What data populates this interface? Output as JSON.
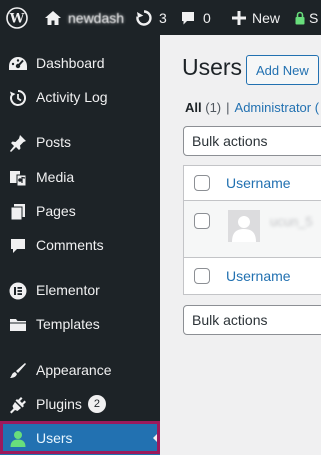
{
  "adminbar": {
    "site_name": "newdash",
    "updates_count": "3",
    "comments_count": "0",
    "new_label": "New",
    "seo_label": "S"
  },
  "sidebar": {
    "items": [
      {
        "label": "Dashboard",
        "icon": "dashboard-icon"
      },
      {
        "label": "Activity Log",
        "icon": "history-icon"
      },
      {
        "label": "Posts",
        "icon": "pin-icon"
      },
      {
        "label": "Media",
        "icon": "media-icon"
      },
      {
        "label": "Pages",
        "icon": "pages-icon"
      },
      {
        "label": "Comments",
        "icon": "comment-icon"
      },
      {
        "label": "Elementor",
        "icon": "elementor-icon"
      },
      {
        "label": "Templates",
        "icon": "folder-icon"
      },
      {
        "label": "Appearance",
        "icon": "brush-icon"
      },
      {
        "label": "Plugins",
        "icon": "plugin-icon",
        "badge": "2"
      },
      {
        "label": "Users",
        "icon": "users-icon",
        "active": true
      }
    ]
  },
  "main": {
    "title": "Users",
    "add_new": "Add New",
    "filters": {
      "all_label": "All",
      "all_count": "(1)",
      "separator": "|",
      "admin_label": "Administrator (",
      "admin_count": ""
    },
    "bulk_actions": "Bulk actions",
    "table": {
      "header_column": "Username",
      "footer_column": "Username",
      "row_username": "ucun_5"
    }
  },
  "colors": {
    "admin_dark": "#1d2327",
    "accent_blue": "#2271b1",
    "focus_ring": "#9c1a5c"
  }
}
